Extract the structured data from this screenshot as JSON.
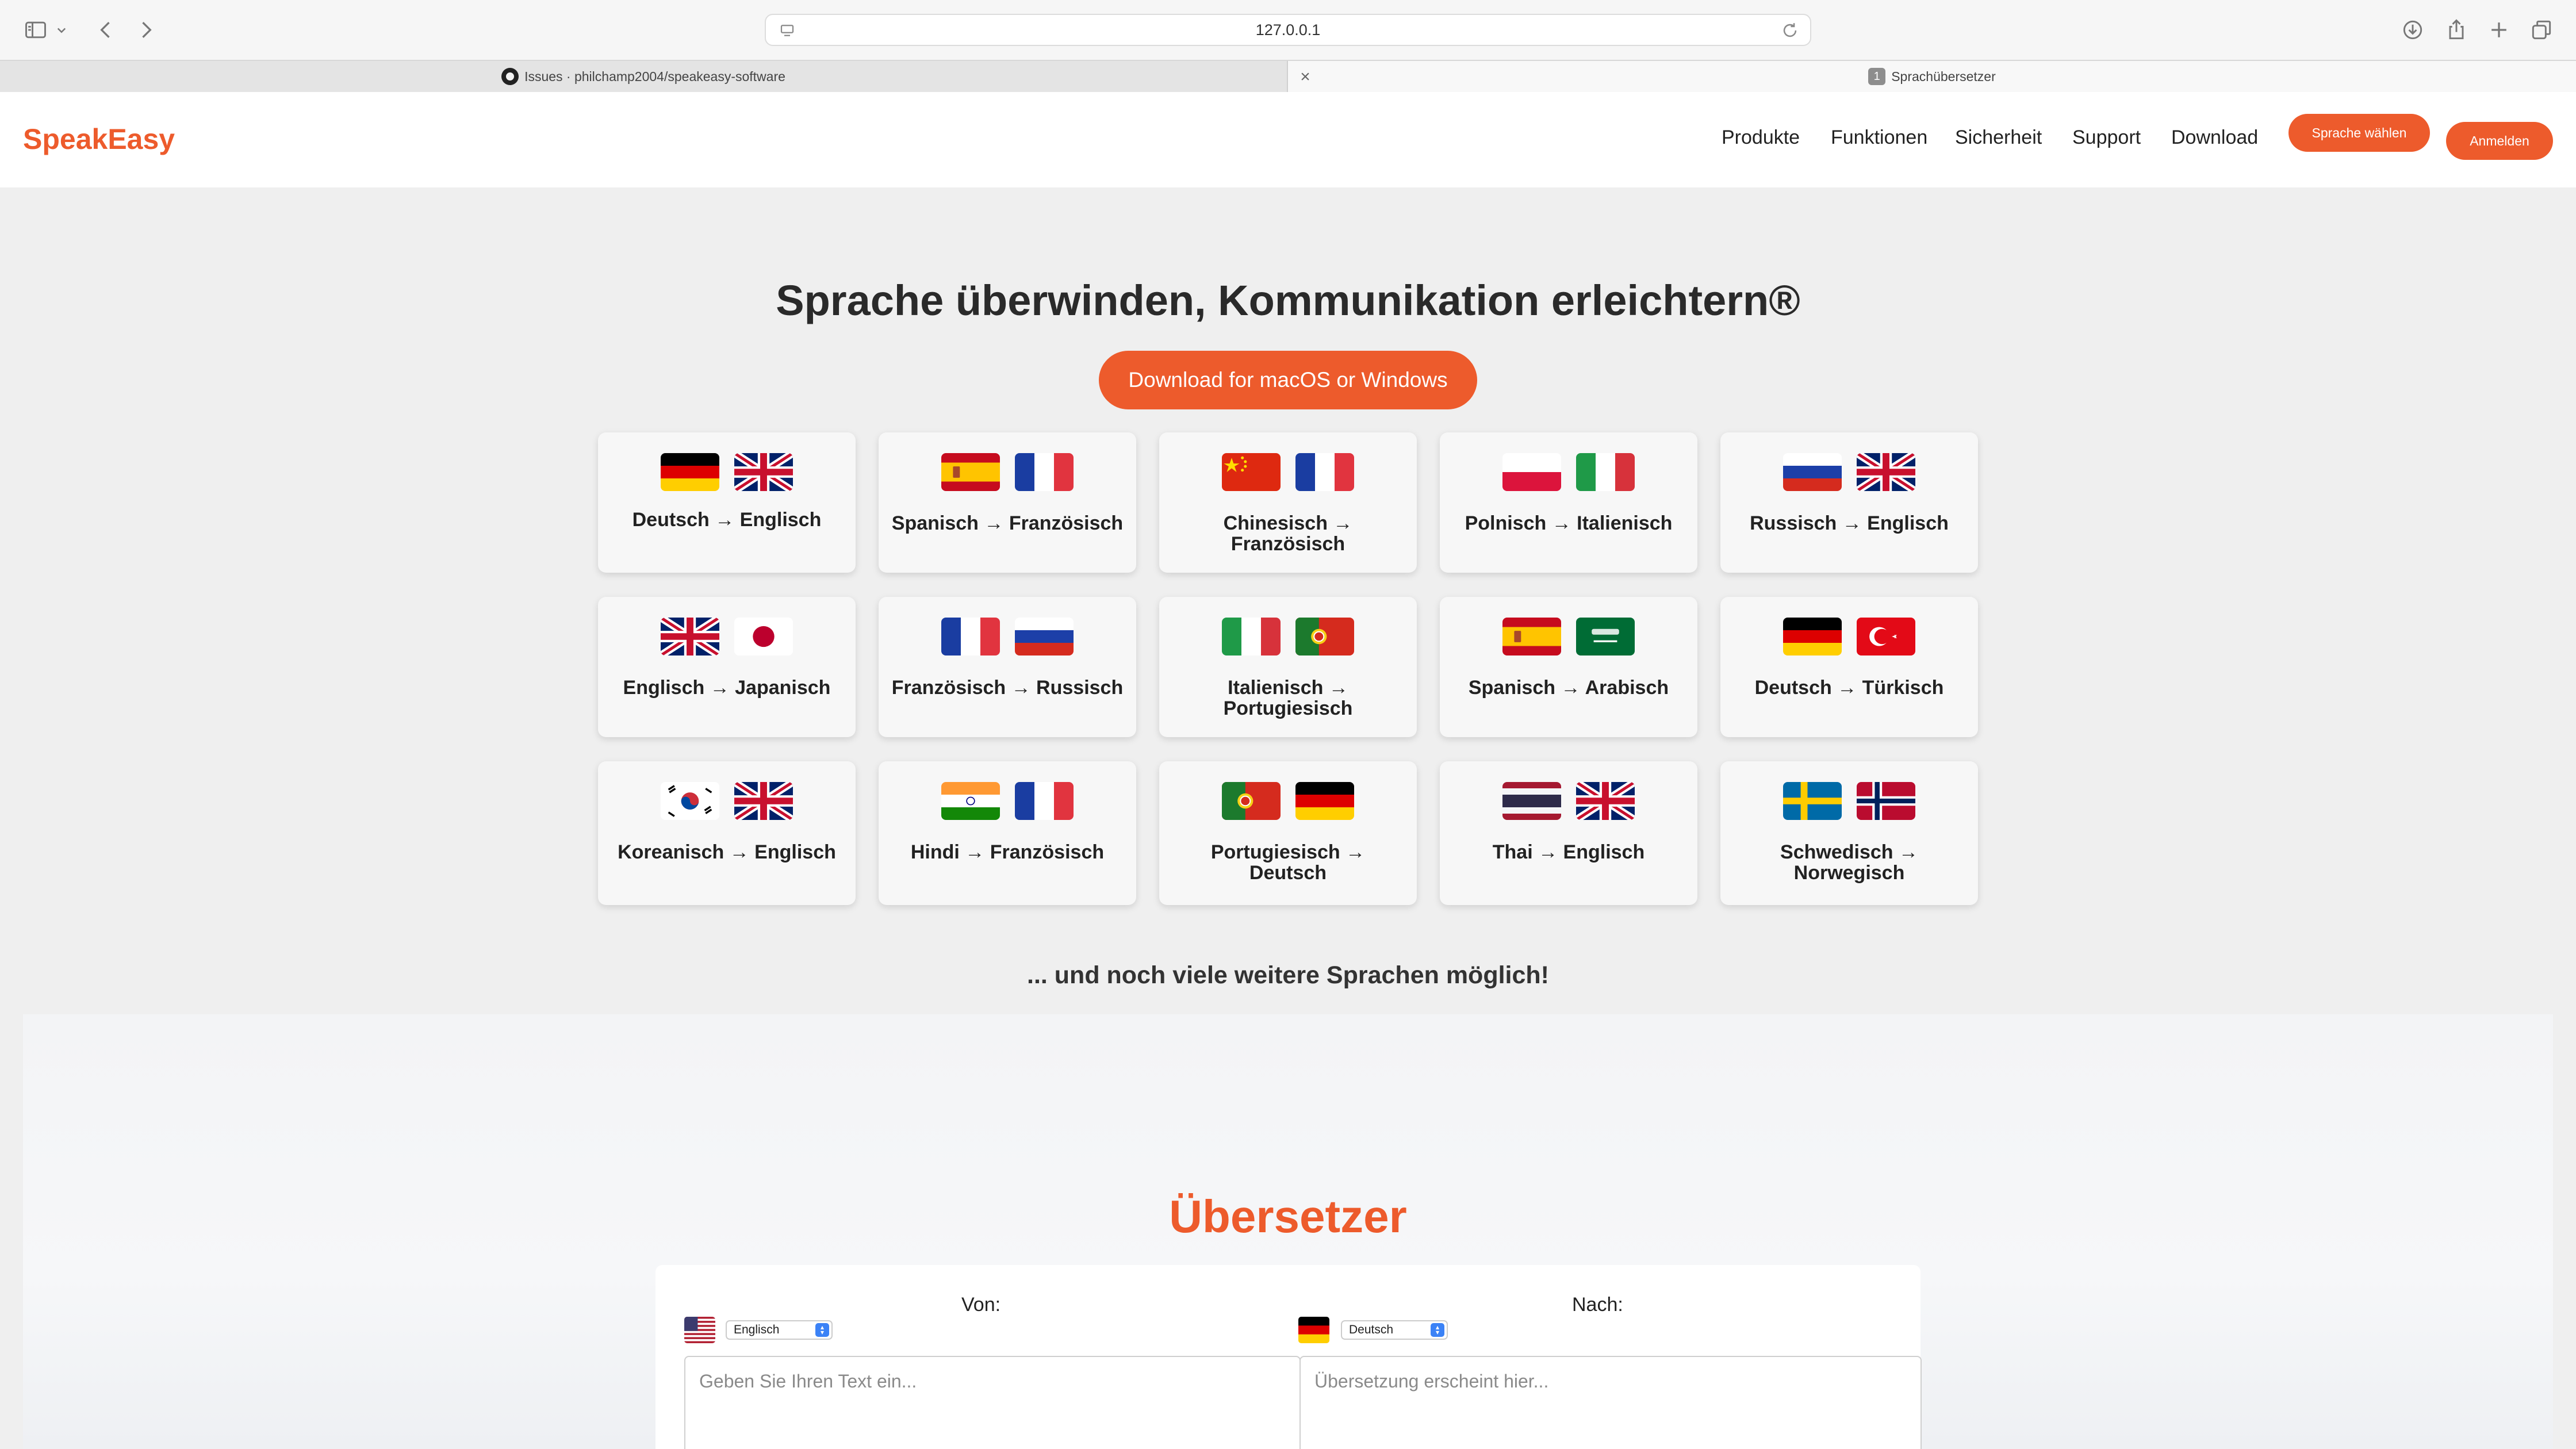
{
  "browser": {
    "url": "127.0.0.1",
    "tabs": [
      {
        "label": "Issues · philchamp2004/speakeasy-software",
        "icon": "github-icon"
      },
      {
        "label": "Sprachübersetzer",
        "badge": "1"
      }
    ]
  },
  "header": {
    "logo": "SpeakEasy",
    "nav": [
      "Produkte",
      "Funktionen",
      "Sicherheit",
      "Support",
      "Download"
    ],
    "language_button": "Sprache wählen",
    "login_button": "Anmelden"
  },
  "hero": {
    "title": "Sprache überwinden, Kommunikation erleichtern®",
    "download_button": "Download for macOS or Windows"
  },
  "pairs": [
    {
      "label": "Deutsch → Englisch",
      "flags": [
        "de",
        "gb"
      ]
    },
    {
      "label": "Spanisch → Französisch",
      "flags": [
        "es",
        "fr"
      ]
    },
    {
      "label": "Chinesisch → Französisch",
      "flags": [
        "cn",
        "fr"
      ]
    },
    {
      "label": "Polnisch → Italienisch",
      "flags": [
        "pl",
        "it"
      ]
    },
    {
      "label": "Russisch → Englisch",
      "flags": [
        "ru",
        "gb"
      ]
    },
    {
      "label": "Englisch → Japanisch",
      "flags": [
        "gb",
        "jp"
      ]
    },
    {
      "label": "Französisch → Russisch",
      "flags": [
        "fr",
        "ru"
      ]
    },
    {
      "label": "Italienisch → Portugiesisch",
      "flags": [
        "it",
        "pt"
      ]
    },
    {
      "label": "Spanisch → Arabisch",
      "flags": [
        "es",
        "sa"
      ]
    },
    {
      "label": "Deutsch → Türkisch",
      "flags": [
        "de",
        "tr"
      ]
    },
    {
      "label": "Koreanisch → Englisch",
      "flags": [
        "kr",
        "gb"
      ]
    },
    {
      "label": "Hindi → Französisch",
      "flags": [
        "in",
        "fr"
      ]
    },
    {
      "label": "Portugiesisch → Deutsch",
      "flags": [
        "pt",
        "de"
      ]
    },
    {
      "label": "Thai → Englisch",
      "flags": [
        "th",
        "gb"
      ]
    },
    {
      "label": "Schwedisch → Norwegisch",
      "flags": [
        "se",
        "no"
      ]
    }
  ],
  "more_text": "... und noch viele weitere Sprachen möglich!",
  "translator": {
    "title": "Übersetzer",
    "from_label": "Von:",
    "to_label": "Nach:",
    "from_language": "Englisch",
    "to_language": "Deutsch",
    "from_flag": "us",
    "to_flag": "de",
    "input_placeholder": "Geben Sie Ihren Text ein...",
    "output_placeholder": "Übersetzung erscheint hier..."
  },
  "colors": {
    "accent": "#ed5b2c",
    "background": "#efefef",
    "card": "#f7f7f7"
  }
}
